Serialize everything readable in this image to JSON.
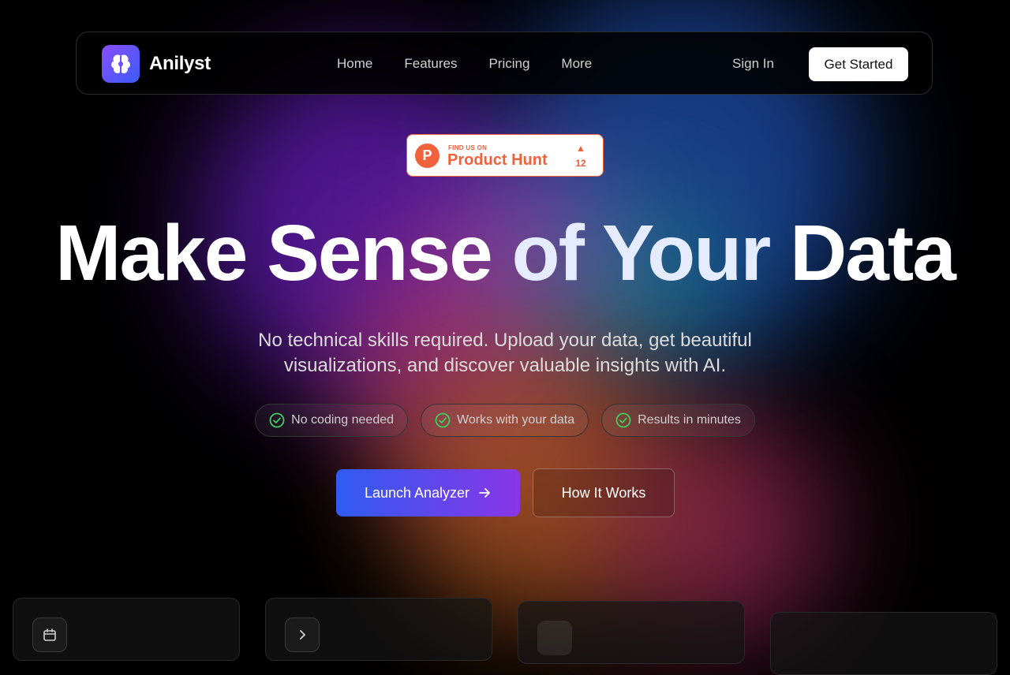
{
  "brand": {
    "name": "Anilyst"
  },
  "nav": {
    "items": [
      "Home",
      "Features",
      "Pricing",
      "More"
    ]
  },
  "auth": {
    "sign_in": "Sign In",
    "get_started": "Get Started"
  },
  "product_hunt": {
    "letter": "P",
    "small": "FIND US ON",
    "name": "Product Hunt",
    "upvotes": "12"
  },
  "hero": {
    "title_part1": "Make Sense",
    "title_part2": "of Your",
    "title_part3": "Data",
    "subtitle": "No technical skills required. Upload your data, get beautiful visualizations, and discover valuable insights with AI."
  },
  "features": [
    "No coding needed",
    "Works with your data",
    "Results in minutes"
  ],
  "cta": {
    "primary": "Launch Analyzer",
    "secondary": "How It Works"
  },
  "colors": {
    "accent_green": "#3ecf5f",
    "product_hunt": "#f0613c",
    "gradient_start": "#2f5cf2",
    "gradient_end": "#8a35e6"
  },
  "icons": {
    "logo": "brain-icon",
    "check": "check-circle-icon",
    "arrow": "arrow-right-icon",
    "calendar": "calendar-icon",
    "chevron": "chevron-right-icon"
  }
}
